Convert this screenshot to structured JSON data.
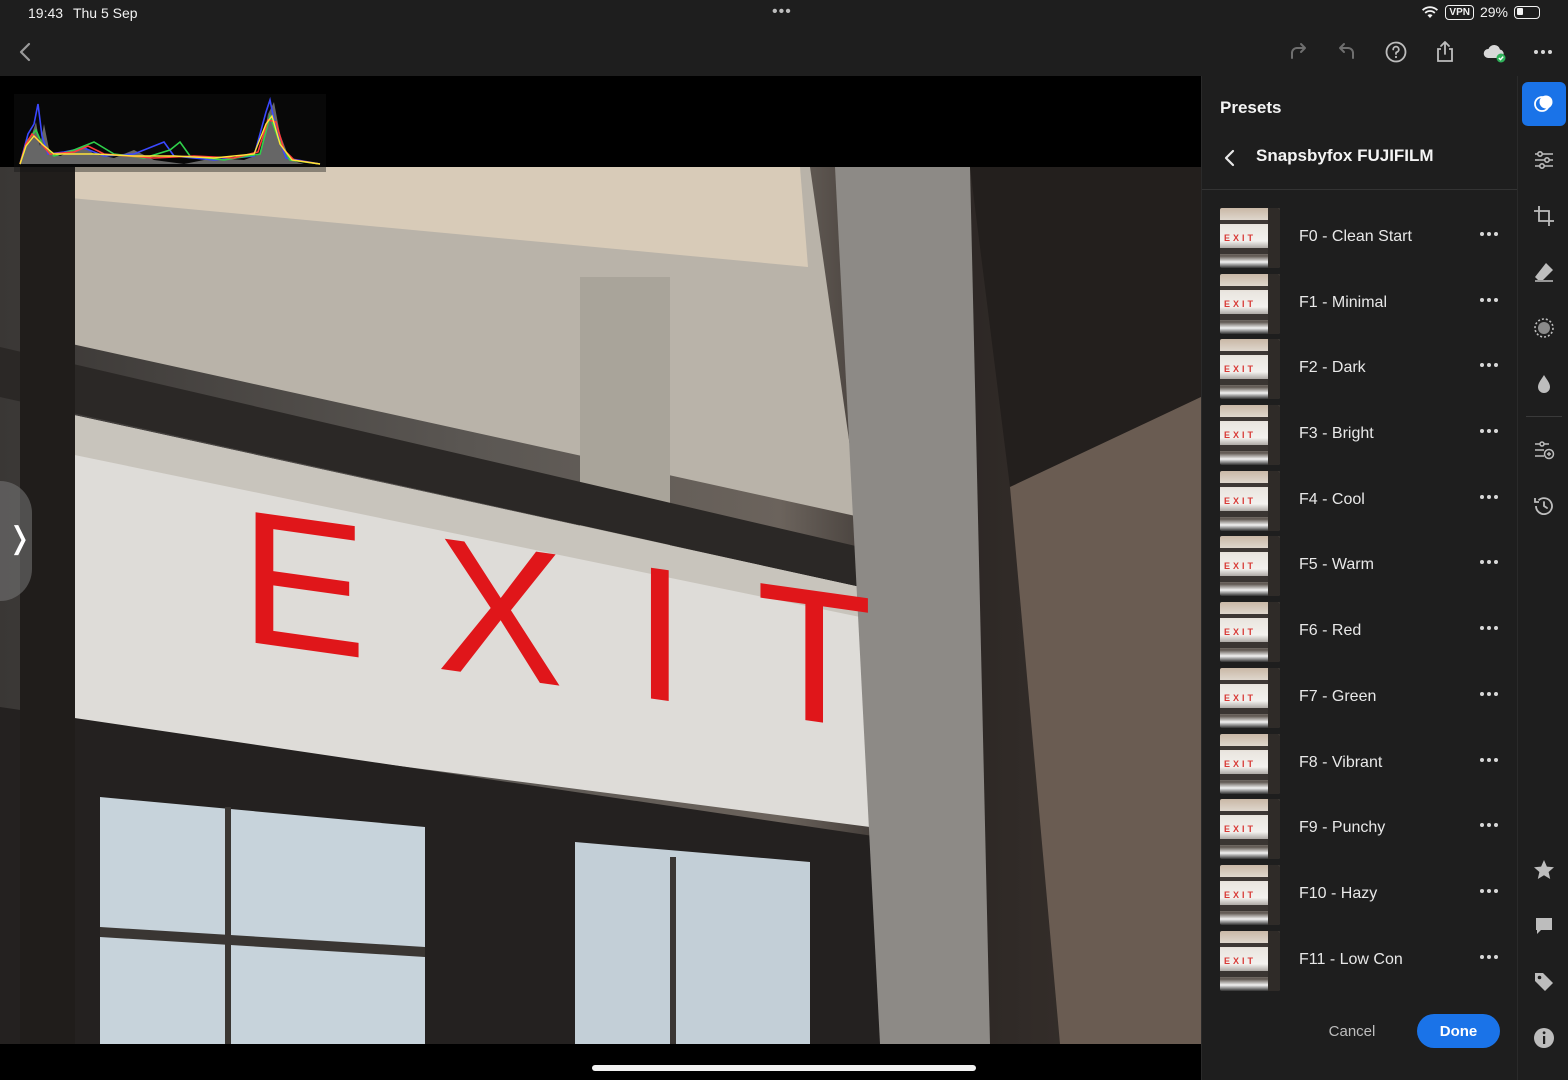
{
  "status": {
    "time": "19:43",
    "date": "Thu 5 Sep",
    "vpn": "VPN",
    "battery_percent": "29%",
    "battery_level": 0.29,
    "multitasking_indicator": "•••"
  },
  "top_bar": {
    "icons": [
      "back-icon",
      "redo-icon",
      "undo-icon",
      "help-icon",
      "share-icon",
      "cloud-sync-icon",
      "more-icon"
    ]
  },
  "panel": {
    "title": "Presets",
    "group_name": "Snapsbyfox FUJIFILM",
    "presets": [
      {
        "name": "F0 - Clean Start"
      },
      {
        "name": "F1 - Minimal"
      },
      {
        "name": "F2 - Dark"
      },
      {
        "name": "F3 - Bright"
      },
      {
        "name": "F4 - Cool"
      },
      {
        "name": "F5 - Warm"
      },
      {
        "name": "F6 - Red"
      },
      {
        "name": "F7 - Green"
      },
      {
        "name": "F8 - Vibrant"
      },
      {
        "name": "F9 - Punchy"
      },
      {
        "name": "F10 - Hazy"
      },
      {
        "name": "F11 - Low Con"
      }
    ],
    "thumb_text": "EXIT",
    "cancel_label": "Cancel",
    "done_label": "Done"
  },
  "photo": {
    "sign_text": "EXIT"
  },
  "rail": {
    "icons": [
      "presets-icon",
      "adjust-sliders-icon",
      "crop-icon",
      "healing-eraser-icon",
      "masking-icon",
      "color-drop-icon",
      "versions-icon",
      "history-icon",
      "star-rating-icon",
      "comment-icon",
      "tag-icon",
      "info-icon"
    ]
  },
  "colors": {
    "accent": "#1a73e8",
    "panel_bg": "#1e1e1e",
    "exit_red": "#e0161a"
  }
}
